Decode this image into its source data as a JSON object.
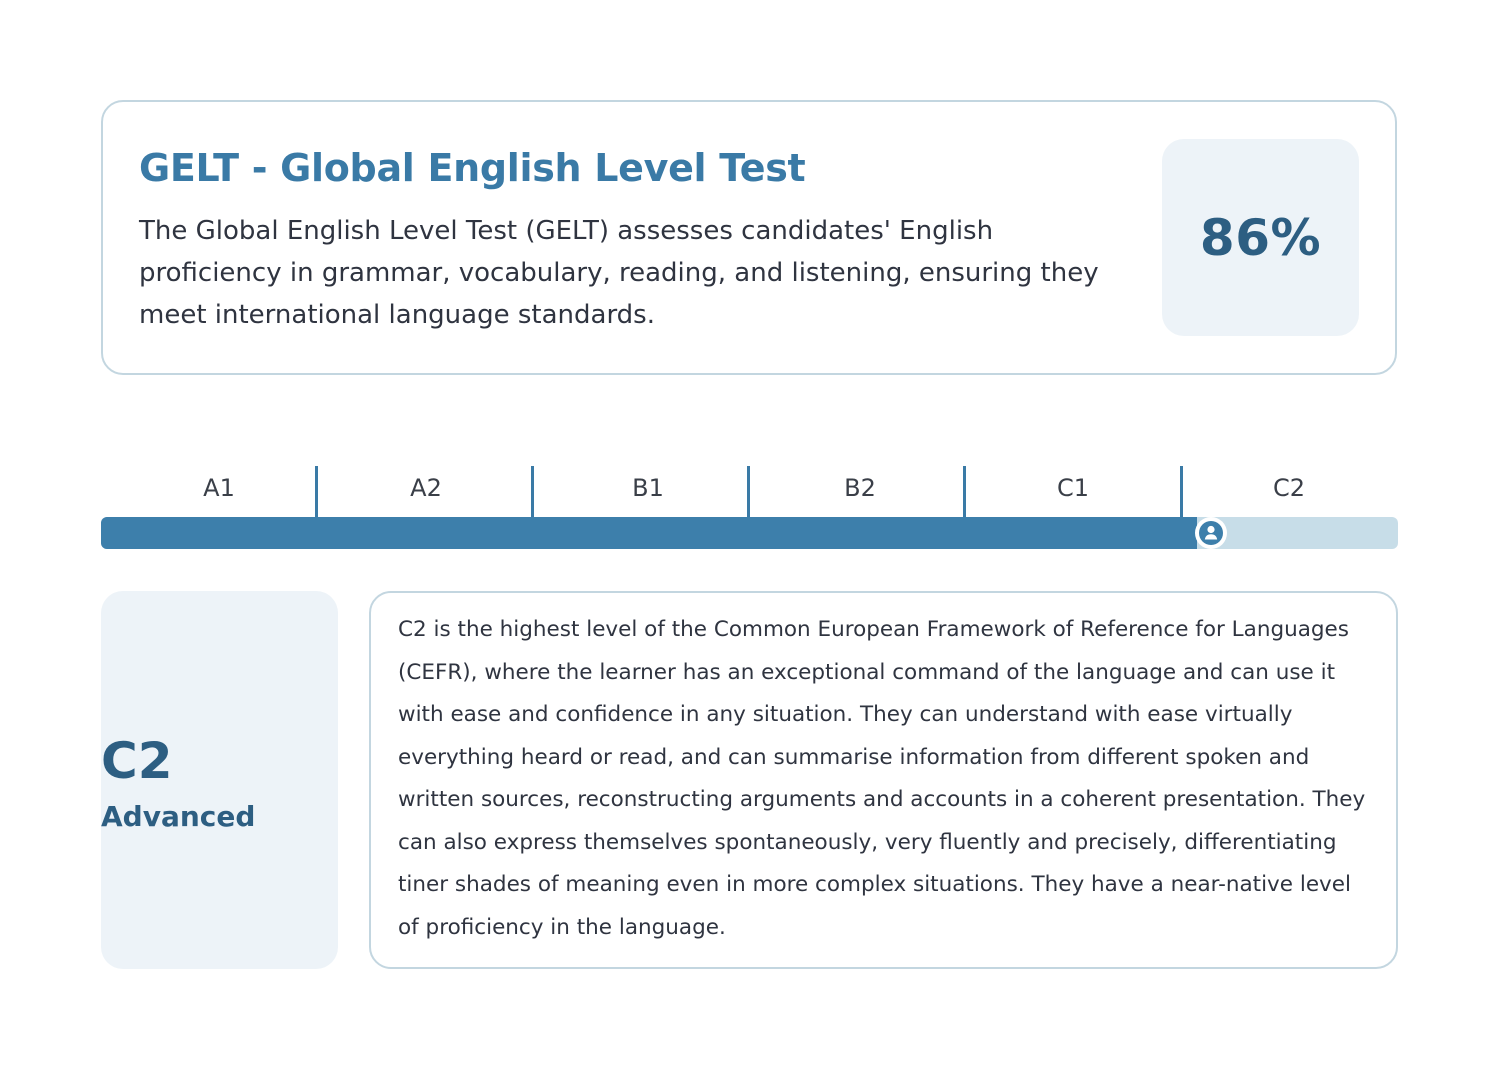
{
  "header": {
    "title": "GELT - Global English Level Test",
    "description": "The Global English Level Test (GELT) assesses candidates' English proficiency in grammar, vocabulary, reading, and listening, ensuring they meet international language standards.",
    "score": "86%"
  },
  "levels": {
    "labels": [
      "A1",
      "A2",
      "B1",
      "B2",
      "C1",
      "C2"
    ],
    "progress_fraction": 0.845,
    "colors": {
      "fill": "#3d7fab",
      "track": "#c7dde8",
      "accent": "#3a7aa6"
    },
    "marker_icon": "user-icon"
  },
  "result": {
    "code": "C2",
    "name": "Advanced",
    "description": "C2 is the highest level of the Common European Framework of Reference for Languages (CEFR), where the learner has an exceptional command of the language and can use it with ease and confidence in any situation. They can understand with ease virtually everything heard or read, and can summarise information from different spoken and written sources, reconstructing arguments and accounts in a coherent presentation. They can also express themselves spontaneously, very fluently and precisely, differentiating tiner shades of meaning even in more complex situations. They have a near-native level of proficiency in the language."
  }
}
